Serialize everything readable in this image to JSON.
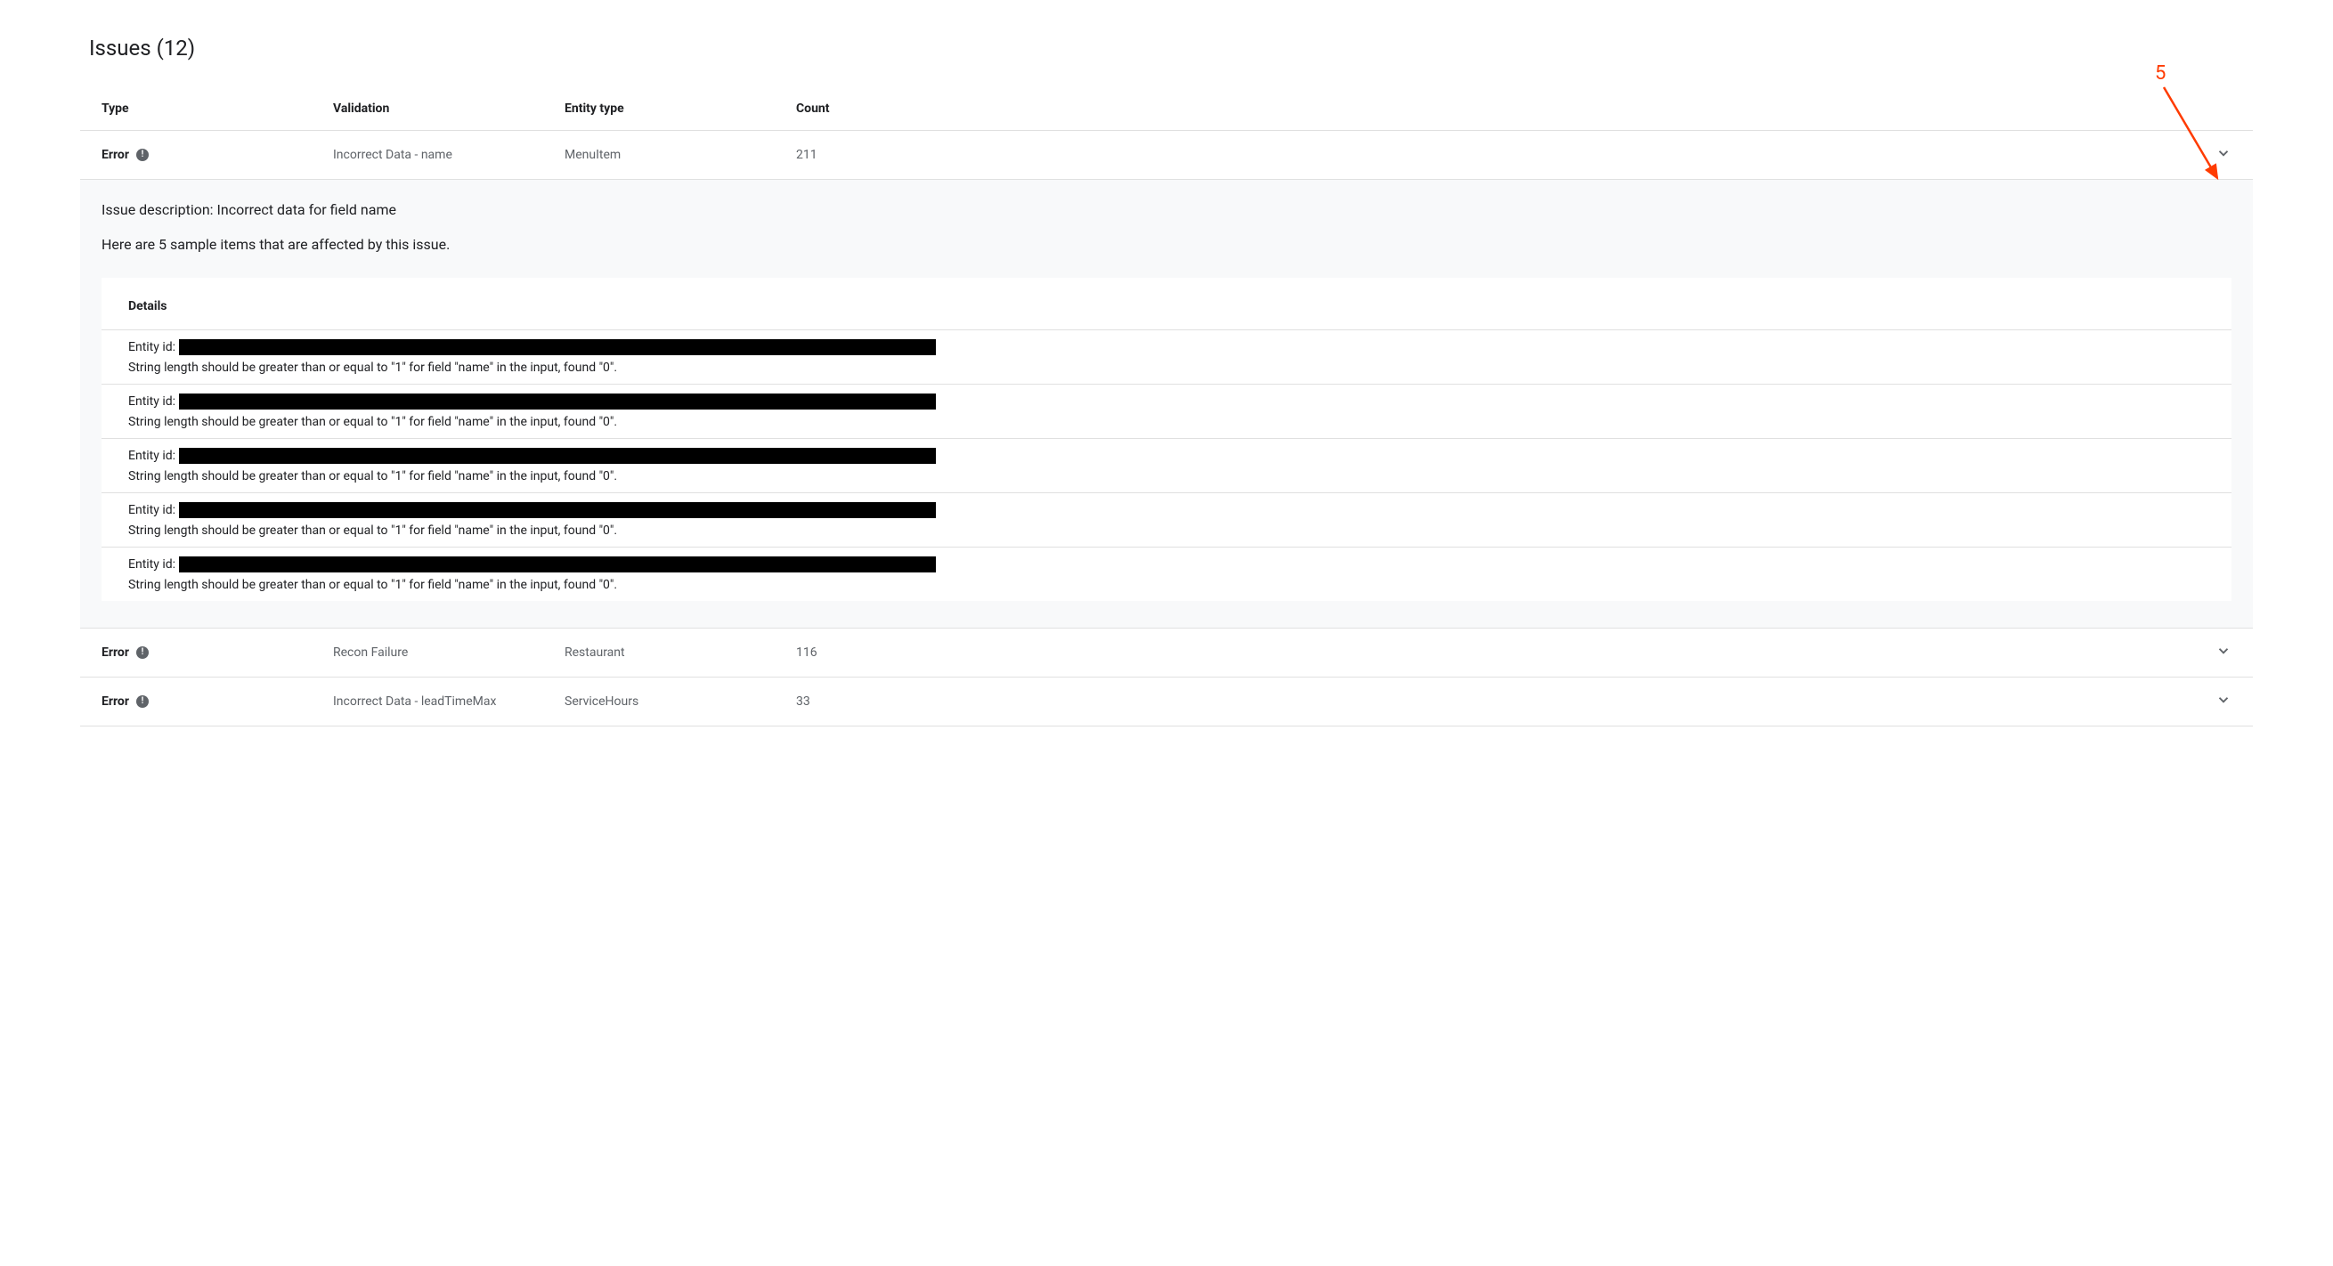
{
  "title": "Issues (12)",
  "headers": {
    "type": "Type",
    "validation": "Validation",
    "entity_type": "Entity type",
    "count": "Count"
  },
  "rows": [
    {
      "type": "Error",
      "validation": "Incorrect Data - name",
      "entity_type": "MenuItem",
      "count": "211",
      "expanded": true,
      "description_label": "Issue description:",
      "description_value": "Incorrect data for field name",
      "sample_text": "Here are 5 sample items that are affected by this issue.",
      "details_heading": "Details",
      "entity_id_label": "Entity id:",
      "details": [
        {
          "message": "String length should be greater than or equal to \"1\" for field \"name\" in the input, found \"0\"."
        },
        {
          "message": "String length should be greater than or equal to \"1\" for field \"name\" in the input, found \"0\"."
        },
        {
          "message": "String length should be greater than or equal to \"1\" for field \"name\" in the input, found \"0\"."
        },
        {
          "message": "String length should be greater than or equal to \"1\" for field \"name\" in the input, found \"0\"."
        },
        {
          "message": "String length should be greater than or equal to \"1\" for field \"name\" in the input, found \"0\"."
        }
      ]
    },
    {
      "type": "Error",
      "validation": "Recon Failure",
      "entity_type": "Restaurant",
      "count": "116",
      "expanded": false
    },
    {
      "type": "Error",
      "validation": "Incorrect Data - leadTimeMax",
      "entity_type": "ServiceHours",
      "count": "33",
      "expanded": false
    }
  ],
  "annotation": {
    "label": "5"
  }
}
